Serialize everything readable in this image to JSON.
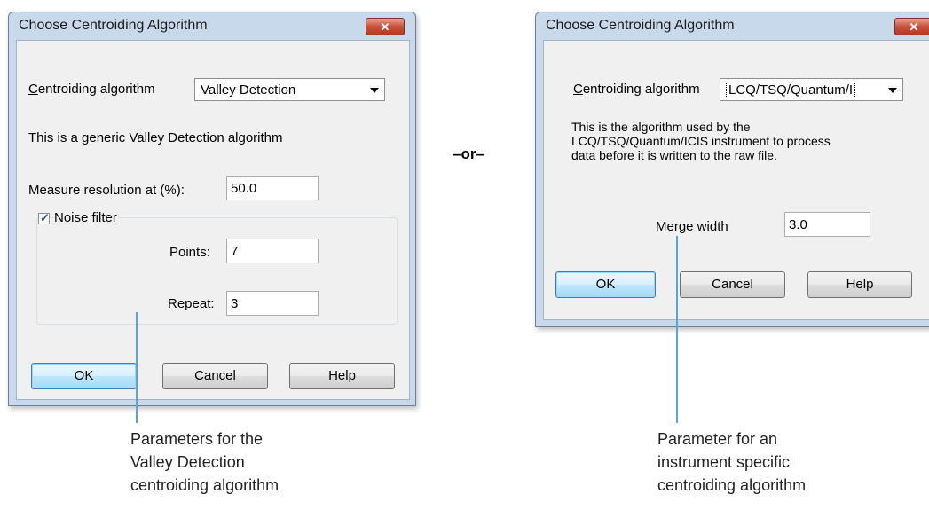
{
  "separator": "–or–",
  "left_dialog": {
    "title": "Choose Centroiding Algorithm",
    "close_label": "✕",
    "algorithm_label": "Centroiding algorithm",
    "algorithm_value": "Valley Detection",
    "description": "This is a generic Valley Detection algorithm",
    "resolution_label": "Measure resolution at (%):",
    "resolution_value": "50.0",
    "noise_filter_label": "Noise filter",
    "noise_filter_checked": true,
    "points_label": "Points:",
    "points_value": "7",
    "repeat_label": "Repeat:",
    "repeat_value": "3",
    "ok_label": "OK",
    "cancel_label": "Cancel",
    "help_label": "Help"
  },
  "right_dialog": {
    "title": "Choose Centroiding Algorithm",
    "close_label": "✕",
    "algorithm_label": "Centroiding algorithm",
    "algorithm_value": "LCQ/TSQ/Quantum/I",
    "description": "This is the algorithm used by the\nLCQ/TSQ/Quantum/ICIS instrument to process\ndata before it is written to the raw file.",
    "merge_label": "Merge width",
    "merge_value": "3.0",
    "ok_label": "OK",
    "cancel_label": "Cancel",
    "help_label": "Help"
  },
  "callouts": {
    "left": "Parameters for the\nValley Detection\ncentroiding algorithm",
    "right": "Parameter for an\ninstrument specific\ncentroiding algorithm"
  },
  "colors": {
    "accent": "#5aa5d6",
    "close_button": "#c7513a",
    "dialog_frame": "#c9d9ec"
  }
}
